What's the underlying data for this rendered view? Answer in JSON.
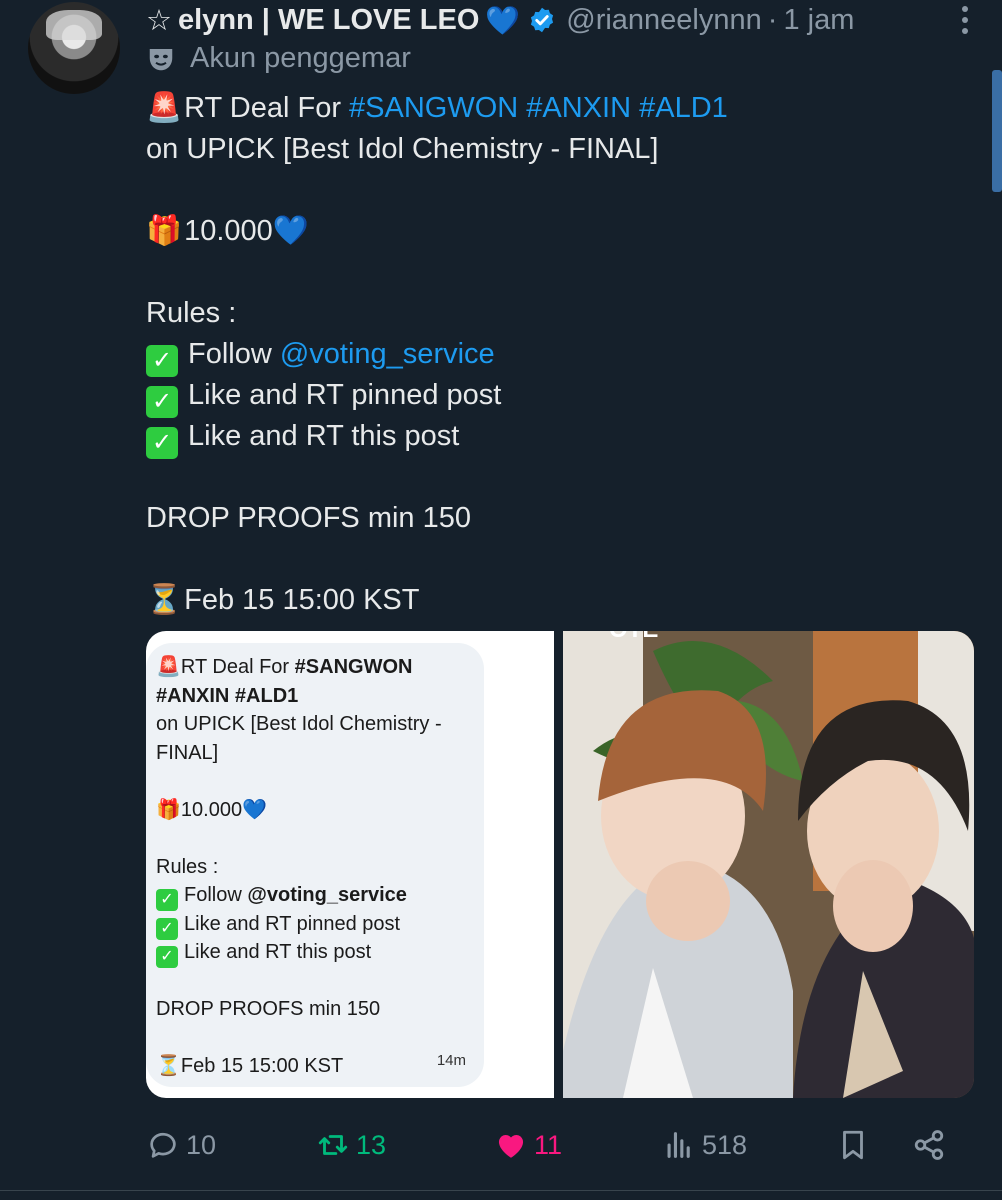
{
  "author": {
    "star": "☆",
    "display_name": "elynn | WE LOVE LEO",
    "heart": "💙",
    "handle": "@rianneelynnn",
    "separator": "·",
    "time": "1 jam",
    "label": "Akun penggemar"
  },
  "tweet": {
    "l1_emoji": "🚨",
    "l1_text": "RT Deal For ",
    "l1_tag1": "#SANGWON",
    "l1_tag2": "#ANXIN",
    "l1_tag3": "#ALD1",
    "l2": "on UPICK [Best Idol Chemistry - FINAL]",
    "l4_emoji": "🎁",
    "l4_text": "10.000",
    "l4_heart": "💙",
    "l6": "Rules :",
    "l7_prefix": "Follow ",
    "l7_mention": "@voting_service",
    "l8": "Like and RT pinned post",
    "l9": "Like and RT this post",
    "l11": "DROP PROOFS min 150",
    "l13_emoji": "⏳",
    "l13_text": "Feb 15 15:00 KST"
  },
  "media_screenshot": {
    "l1_emoji": "🚨",
    "l1_text": "RT Deal For ",
    "l1_bold": "#SANGWON",
    "l2_bold": "#ANXIN #ALD1",
    "l3": "on UPICK [Best Idol Chemistry -",
    "l4": "FINAL]",
    "l6_emoji": "🎁",
    "l6_text": "10.000",
    "l6_heart": "💙",
    "l8": "Rules :",
    "l9_prefix": "Follow ",
    "l9_bold": "@voting_service",
    "l10": "Like and RT pinned post",
    "l11": "Like and RT this post",
    "l13": "DROP PROOFS min 150",
    "l15_emoji": "⏳",
    "l15_text": "Feb 15 15:00 KST",
    "time": "14m",
    "photo_top_text": "OTE"
  },
  "actions": {
    "replies": "10",
    "retweets": "13",
    "likes": "11",
    "views": "518"
  },
  "colors": {
    "background": "#15202b",
    "link": "#1d9bf0",
    "retweet": "#00ba7c",
    "like": "#f91880",
    "muted": "#8b98a5"
  },
  "icons": [
    "verified-badge-icon",
    "more-dots-icon",
    "mask-icon",
    "reply-icon",
    "retweet-icon",
    "heart-icon",
    "views-icon",
    "bookmark-icon",
    "share-icon"
  ]
}
